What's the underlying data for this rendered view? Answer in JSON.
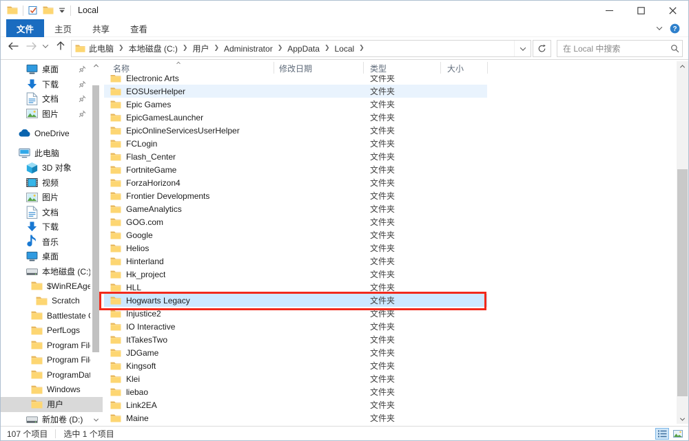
{
  "titlebar": {
    "title": "Local",
    "qat_icons": [
      "folder-icon",
      "properties-checkbox-icon",
      "folder-icon",
      "qat-dropdown-icon"
    ]
  },
  "ribbon": {
    "tabs": [
      {
        "label": "文件",
        "active": true
      },
      {
        "label": "主页",
        "active": false
      },
      {
        "label": "共享",
        "active": false
      },
      {
        "label": "查看",
        "active": false
      }
    ]
  },
  "toolbar": {
    "breadcrumb": [
      "此电脑",
      "本地磁盘 (C:)",
      "用户",
      "Administrator",
      "AppData",
      "Local"
    ],
    "search_placeholder": "在 Local 中搜索"
  },
  "sidebar": {
    "items": [
      {
        "label": "桌面",
        "icon": "desktop",
        "indent": 1,
        "pinned": true
      },
      {
        "label": "下载",
        "icon": "download",
        "indent": 1,
        "pinned": true
      },
      {
        "label": "文档",
        "icon": "document",
        "indent": 1,
        "pinned": true
      },
      {
        "label": "图片",
        "icon": "picture",
        "indent": 1,
        "pinned": true
      },
      {
        "label": "OneDrive",
        "icon": "onedrive",
        "indent": 0,
        "gap": true
      },
      {
        "label": "此电脑",
        "icon": "computer",
        "indent": 0,
        "gap": true
      },
      {
        "label": "3D 对象",
        "icon": "cube",
        "indent": 1
      },
      {
        "label": "视频",
        "icon": "video",
        "indent": 1
      },
      {
        "label": "图片",
        "icon": "picture",
        "indent": 1
      },
      {
        "label": "文档",
        "icon": "document",
        "indent": 1
      },
      {
        "label": "下载",
        "icon": "download",
        "indent": 1
      },
      {
        "label": "音乐",
        "icon": "music",
        "indent": 1
      },
      {
        "label": "桌面",
        "icon": "desktop",
        "indent": 1
      },
      {
        "label": "本地磁盘 (C:)",
        "icon": "drive",
        "indent": 1
      },
      {
        "label": "$WinREAgent",
        "icon": "folder",
        "indent": 2
      },
      {
        "label": "Scratch",
        "icon": "folder",
        "indent": 3
      },
      {
        "label": "Battlestate Ga",
        "icon": "folder",
        "indent": 2
      },
      {
        "label": "PerfLogs",
        "icon": "folder",
        "indent": 2
      },
      {
        "label": "Program Files",
        "icon": "folder",
        "indent": 2
      },
      {
        "label": "Program Files",
        "icon": "folder",
        "indent": 2
      },
      {
        "label": "ProgramData",
        "icon": "folder",
        "indent": 2
      },
      {
        "label": "Windows",
        "icon": "folder",
        "indent": 2
      },
      {
        "label": "用户",
        "icon": "folder",
        "indent": 2,
        "selected": true
      },
      {
        "label": "新加卷 (D:)",
        "icon": "drive",
        "indent": 1
      }
    ]
  },
  "filelist": {
    "columns": [
      "名称",
      "修改日期",
      "类型",
      "大小"
    ],
    "rows": [
      {
        "name": "Electronic Arts",
        "date": "",
        "type": "文件夹",
        "size": ""
      },
      {
        "name": "EOSUserHelper",
        "date": "",
        "type": "文件夹",
        "size": ""
      },
      {
        "name": "Epic Games",
        "date": "",
        "type": "文件夹",
        "size": ""
      },
      {
        "name": "EpicGamesLauncher",
        "date": "",
        "type": "文件夹",
        "size": ""
      },
      {
        "name": "EpicOnlineServicesUserHelper",
        "date": "",
        "type": "文件夹",
        "size": ""
      },
      {
        "name": "FCLogin",
        "date": "",
        "type": "文件夹",
        "size": ""
      },
      {
        "name": "Flash_Center",
        "date": "",
        "type": "文件夹",
        "size": ""
      },
      {
        "name": "FortniteGame",
        "date": "",
        "type": "文件夹",
        "size": ""
      },
      {
        "name": "ForzaHorizon4",
        "date": "",
        "type": "文件夹",
        "size": ""
      },
      {
        "name": "Frontier Developments",
        "date": "",
        "type": "文件夹",
        "size": ""
      },
      {
        "name": "GameAnalytics",
        "date": "",
        "type": "文件夹",
        "size": ""
      },
      {
        "name": "GOG.com",
        "date": "",
        "type": "文件夹",
        "size": ""
      },
      {
        "name": "Google",
        "date": "",
        "type": "文件夹",
        "size": ""
      },
      {
        "name": "Helios",
        "date": "",
        "type": "文件夹",
        "size": ""
      },
      {
        "name": "Hinterland",
        "date": "",
        "type": "文件夹",
        "size": ""
      },
      {
        "name": "Hk_project",
        "date": "",
        "type": "文件夹",
        "size": ""
      },
      {
        "name": "HLL",
        "date": "",
        "type": "文件夹",
        "size": ""
      },
      {
        "name": "Hogwarts Legacy",
        "date": "",
        "type": "文件夹",
        "size": ""
      },
      {
        "name": "Injustice2",
        "date": "",
        "type": "文件夹",
        "size": ""
      },
      {
        "name": "IO Interactive",
        "date": "",
        "type": "文件夹",
        "size": ""
      },
      {
        "name": "ItTakesTwo",
        "date": "",
        "type": "文件夹",
        "size": ""
      },
      {
        "name": "JDGame",
        "date": "",
        "type": "文件夹",
        "size": ""
      },
      {
        "name": "Kingsoft",
        "date": "",
        "type": "文件夹",
        "size": ""
      },
      {
        "name": "Klei",
        "date": "",
        "type": "文件夹",
        "size": ""
      },
      {
        "name": "liebao",
        "date": "",
        "type": "文件夹",
        "size": ""
      },
      {
        "name": "Link2EA",
        "date": "",
        "type": "文件夹",
        "size": ""
      },
      {
        "name": "Maine",
        "date": "",
        "type": "文件夹",
        "size": ""
      }
    ],
    "hover_row": "EOSUserHelper",
    "selected_row": "Hogwarts Legacy",
    "annotation": {
      "target": "Hogwarts Legacy",
      "color": "#f2291b"
    }
  },
  "statusbar": {
    "items_count": "107 个项目",
    "selected_count": "选中 1 个项目"
  },
  "colors": {
    "accent_tab": "#1a6cc0",
    "selection": "#cde8ff",
    "hover": "#e9f3fd",
    "sidebar_selection": "#d9d9d9"
  }
}
